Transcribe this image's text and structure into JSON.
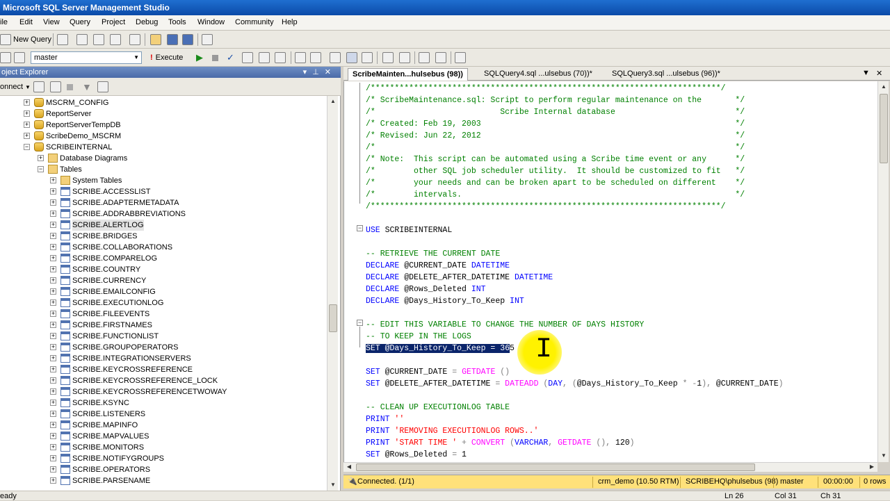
{
  "window": {
    "title": "Microsoft SQL Server Management Studio"
  },
  "menu": [
    "ile",
    "Edit",
    "View",
    "Query",
    "Project",
    "Debug",
    "Tools",
    "Window",
    "Community",
    "Help"
  ],
  "toolbar": {
    "new_query": "New Query",
    "database": "master",
    "execute": "Execute"
  },
  "object_explorer": {
    "title": "oject Explorer",
    "connect": "onnect",
    "nodes": [
      {
        "label": "MSCRM_CONFIG",
        "type": "db",
        "level": 0,
        "exp": "+"
      },
      {
        "label": "ReportServer",
        "type": "db",
        "level": 0,
        "exp": "+"
      },
      {
        "label": "ReportServerTempDB",
        "type": "db",
        "level": 0,
        "exp": "+"
      },
      {
        "label": "ScribeDemo_MSCRM",
        "type": "db",
        "level": 0,
        "exp": "+"
      },
      {
        "label": "SCRIBEINTERNAL",
        "type": "db",
        "level": 0,
        "exp": "-"
      },
      {
        "label": "Database Diagrams",
        "type": "folder",
        "level": 1,
        "exp": "+"
      },
      {
        "label": "Tables",
        "type": "folder",
        "level": 1,
        "exp": "-"
      },
      {
        "label": "System Tables",
        "type": "folder",
        "level": 2,
        "exp": "+"
      },
      {
        "label": "SCRIBE.ACCESSLIST",
        "type": "table",
        "level": 2,
        "exp": "+"
      },
      {
        "label": "SCRIBE.ADAPTERMETADATA",
        "type": "table",
        "level": 2,
        "exp": "+"
      },
      {
        "label": "SCRIBE.ADDRABBREVIATIONS",
        "type": "table",
        "level": 2,
        "exp": "+"
      },
      {
        "label": "SCRIBE.ALERTLOG",
        "type": "table",
        "level": 2,
        "exp": "+",
        "selected": true
      },
      {
        "label": "SCRIBE.BRIDGES",
        "type": "table",
        "level": 2,
        "exp": "+"
      },
      {
        "label": "SCRIBE.COLLABORATIONS",
        "type": "table",
        "level": 2,
        "exp": "+"
      },
      {
        "label": "SCRIBE.COMPARELOG",
        "type": "table",
        "level": 2,
        "exp": "+"
      },
      {
        "label": "SCRIBE.COUNTRY",
        "type": "table",
        "level": 2,
        "exp": "+"
      },
      {
        "label": "SCRIBE.CURRENCY",
        "type": "table",
        "level": 2,
        "exp": "+"
      },
      {
        "label": "SCRIBE.EMAILCONFIG",
        "type": "table",
        "level": 2,
        "exp": "+"
      },
      {
        "label": "SCRIBE.EXECUTIONLOG",
        "type": "table",
        "level": 2,
        "exp": "+"
      },
      {
        "label": "SCRIBE.FILEEVENTS",
        "type": "table",
        "level": 2,
        "exp": "+"
      },
      {
        "label": "SCRIBE.FIRSTNAMES",
        "type": "table",
        "level": 2,
        "exp": "+"
      },
      {
        "label": "SCRIBE.FUNCTIONLIST",
        "type": "table",
        "level": 2,
        "exp": "+"
      },
      {
        "label": "SCRIBE.GROUPOPERATORS",
        "type": "table",
        "level": 2,
        "exp": "+"
      },
      {
        "label": "SCRIBE.INTEGRATIONSERVERS",
        "type": "table",
        "level": 2,
        "exp": "+"
      },
      {
        "label": "SCRIBE.KEYCROSSREFERENCE",
        "type": "table",
        "level": 2,
        "exp": "+"
      },
      {
        "label": "SCRIBE.KEYCROSSREFERENCE_LOCK",
        "type": "table",
        "level": 2,
        "exp": "+"
      },
      {
        "label": "SCRIBE.KEYCROSSREFERENCETWOWAY",
        "type": "table",
        "level": 2,
        "exp": "+"
      },
      {
        "label": "SCRIBE.KSYNC",
        "type": "table",
        "level": 2,
        "exp": "+"
      },
      {
        "label": "SCRIBE.LISTENERS",
        "type": "table",
        "level": 2,
        "exp": "+"
      },
      {
        "label": "SCRIBE.MAPINFO",
        "type": "table",
        "level": 2,
        "exp": "+"
      },
      {
        "label": "SCRIBE.MAPVALUES",
        "type": "table",
        "level": 2,
        "exp": "+"
      },
      {
        "label": "SCRIBE.MONITORS",
        "type": "table",
        "level": 2,
        "exp": "+"
      },
      {
        "label": "SCRIBE.NOTIFYGROUPS",
        "type": "table",
        "level": 2,
        "exp": "+"
      },
      {
        "label": "SCRIBE.OPERATORS",
        "type": "table",
        "level": 2,
        "exp": "+"
      },
      {
        "label": "SCRIBE.PARSENAME",
        "type": "table",
        "level": 2,
        "exp": "+"
      }
    ]
  },
  "tabs": [
    {
      "label": "ScribeMainten...hulsebus (98))",
      "active": true
    },
    {
      "label": "SQLQuery4.sql ...ulsebus (70))*",
      "active": false
    },
    {
      "label": "SQLQuery3.sql ...ulsebus (96))*",
      "active": false
    }
  ],
  "code": [
    {
      "row": 0,
      "tokens": [
        [
          "c",
          "/*************************************************************************/"
        ]
      ]
    },
    {
      "row": 1,
      "tokens": [
        [
          "c",
          "/* ScribeMaintenance.sql: Script to perform regular maintenance on the       */"
        ]
      ]
    },
    {
      "row": 2,
      "tokens": [
        [
          "c",
          "/*                          Scribe Internal database                         */"
        ]
      ]
    },
    {
      "row": 3,
      "tokens": [
        [
          "c",
          "/* Created: Feb 19, 2003                                                     */"
        ]
      ]
    },
    {
      "row": 4,
      "tokens": [
        [
          "c",
          "/* Revised: Jun 22, 2012                                                     */"
        ]
      ]
    },
    {
      "row": 5,
      "tokens": [
        [
          "c",
          "/*                                                                           */"
        ]
      ]
    },
    {
      "row": 6,
      "tokens": [
        [
          "c",
          "/* Note:  This script can be automated using a Scribe time event or any      */"
        ]
      ]
    },
    {
      "row": 7,
      "tokens": [
        [
          "c",
          "/*        other SQL job scheduler utility.  It should be customized to fit   */"
        ]
      ]
    },
    {
      "row": 8,
      "tokens": [
        [
          "c",
          "/*        your needs and can be broken apart to be scheduled on different    */"
        ]
      ]
    },
    {
      "row": 9,
      "tokens": [
        [
          "c",
          "/*        intervals.                                                         */"
        ]
      ]
    },
    {
      "row": 10,
      "tokens": [
        [
          "c",
          "/*************************************************************************/"
        ]
      ]
    },
    {
      "row": 12,
      "tokens": [
        [
          "k",
          "USE"
        ],
        [
          "t",
          " SCRIBEINTERNAL"
        ]
      ]
    },
    {
      "row": 14,
      "tokens": [
        [
          "c",
          "-- RETRIEVE THE CURRENT DATE"
        ]
      ]
    },
    {
      "row": 15,
      "tokens": [
        [
          "k",
          "DECLARE"
        ],
        [
          "t",
          " @CURRENT_DATE "
        ],
        [
          "k",
          "DATETIME"
        ]
      ]
    },
    {
      "row": 16,
      "tokens": [
        [
          "k",
          "DECLARE"
        ],
        [
          "t",
          " @DELETE_AFTER_DATETIME "
        ],
        [
          "k",
          "DATETIME"
        ]
      ]
    },
    {
      "row": 17,
      "tokens": [
        [
          "k",
          "DECLARE"
        ],
        [
          "t",
          " @Rows_Deleted "
        ],
        [
          "k",
          "INT"
        ]
      ]
    },
    {
      "row": 18,
      "tokens": [
        [
          "k",
          "DECLARE"
        ],
        [
          "t",
          " @Days_History_To_Keep "
        ],
        [
          "k",
          "INT"
        ]
      ]
    },
    {
      "row": 20,
      "tokens": [
        [
          "c",
          "-- EDIT THIS VARIABLE TO CHANGE THE NUMBER OF DAYS HISTORY"
        ]
      ]
    },
    {
      "row": 21,
      "tokens": [
        [
          "c",
          "-- TO KEEP IN THE LOGS"
        ]
      ]
    },
    {
      "row": 22,
      "tokens": [
        [
          "h",
          "SET @Days_History_To_Keep = 36"
        ],
        [
          "t",
          "5"
        ]
      ]
    },
    {
      "row": 24,
      "tokens": [
        [
          "k",
          "SET"
        ],
        [
          "t",
          " @CURRENT_DATE "
        ],
        [
          "g",
          "="
        ],
        [
          "t",
          " "
        ],
        [
          "f",
          "GETDATE"
        ],
        [
          "t",
          " "
        ],
        [
          "g",
          "()"
        ]
      ]
    },
    {
      "row": 25,
      "tokens": [
        [
          "k",
          "SET"
        ],
        [
          "t",
          " @DELETE_AFTER_DATETIME "
        ],
        [
          "g",
          "="
        ],
        [
          "t",
          " "
        ],
        [
          "f",
          "DATEADD"
        ],
        [
          "t",
          " "
        ],
        [
          "g",
          "("
        ],
        [
          "k",
          "DAY"
        ],
        [
          "g",
          ","
        ],
        [
          "t",
          " "
        ],
        [
          "g",
          "("
        ],
        [
          "t",
          "@Days_History_To_Keep "
        ],
        [
          "g",
          "*"
        ],
        [
          "t",
          " "
        ],
        [
          "g",
          "-"
        ],
        [
          "t",
          "1"
        ],
        [
          "g",
          "),"
        ],
        [
          "t",
          " @CURRENT_DATE"
        ],
        [
          "g",
          ")"
        ]
      ]
    },
    {
      "row": 27,
      "tokens": [
        [
          "c",
          "-- CLEAN UP EXECUTIONLOG TABLE"
        ]
      ]
    },
    {
      "row": 28,
      "tokens": [
        [
          "k",
          "PRINT"
        ],
        [
          "t",
          " "
        ],
        [
          "s",
          "''"
        ]
      ]
    },
    {
      "row": 29,
      "tokens": [
        [
          "k",
          "PRINT"
        ],
        [
          "t",
          " "
        ],
        [
          "s",
          "'REMOVING EXECUTIONLOG ROWS..'"
        ]
      ]
    },
    {
      "row": 30,
      "tokens": [
        [
          "k",
          "PRINT"
        ],
        [
          "t",
          " "
        ],
        [
          "s",
          "'START TIME '"
        ],
        [
          "t",
          " "
        ],
        [
          "g",
          "+"
        ],
        [
          "t",
          " "
        ],
        [
          "f",
          "CONVERT"
        ],
        [
          "t",
          " "
        ],
        [
          "g",
          "("
        ],
        [
          "k",
          "VARCHAR"
        ],
        [
          "g",
          ","
        ],
        [
          "t",
          " "
        ],
        [
          "f",
          "GETDATE"
        ],
        [
          "t",
          " "
        ],
        [
          "g",
          "(),"
        ],
        [
          "t",
          " 120"
        ],
        [
          "g",
          ")"
        ]
      ]
    },
    {
      "row": 31,
      "tokens": [
        [
          "k",
          "SET"
        ],
        [
          "t",
          " @Rows_Deleted "
        ],
        [
          "g",
          "="
        ],
        [
          "t",
          " 1"
        ]
      ]
    }
  ],
  "status": {
    "connected": "Connected. (1/1)",
    "server": "crm_demo (10.50 RTM)",
    "user": "SCRIBEHQ\\phulsebus (98)",
    "db": "master",
    "time": "00:00:00",
    "rows": "0 rows"
  },
  "app_status": {
    "left": "eady",
    "ln": "Ln 26",
    "col": "Col 31",
    "ch": "Ch 31"
  }
}
